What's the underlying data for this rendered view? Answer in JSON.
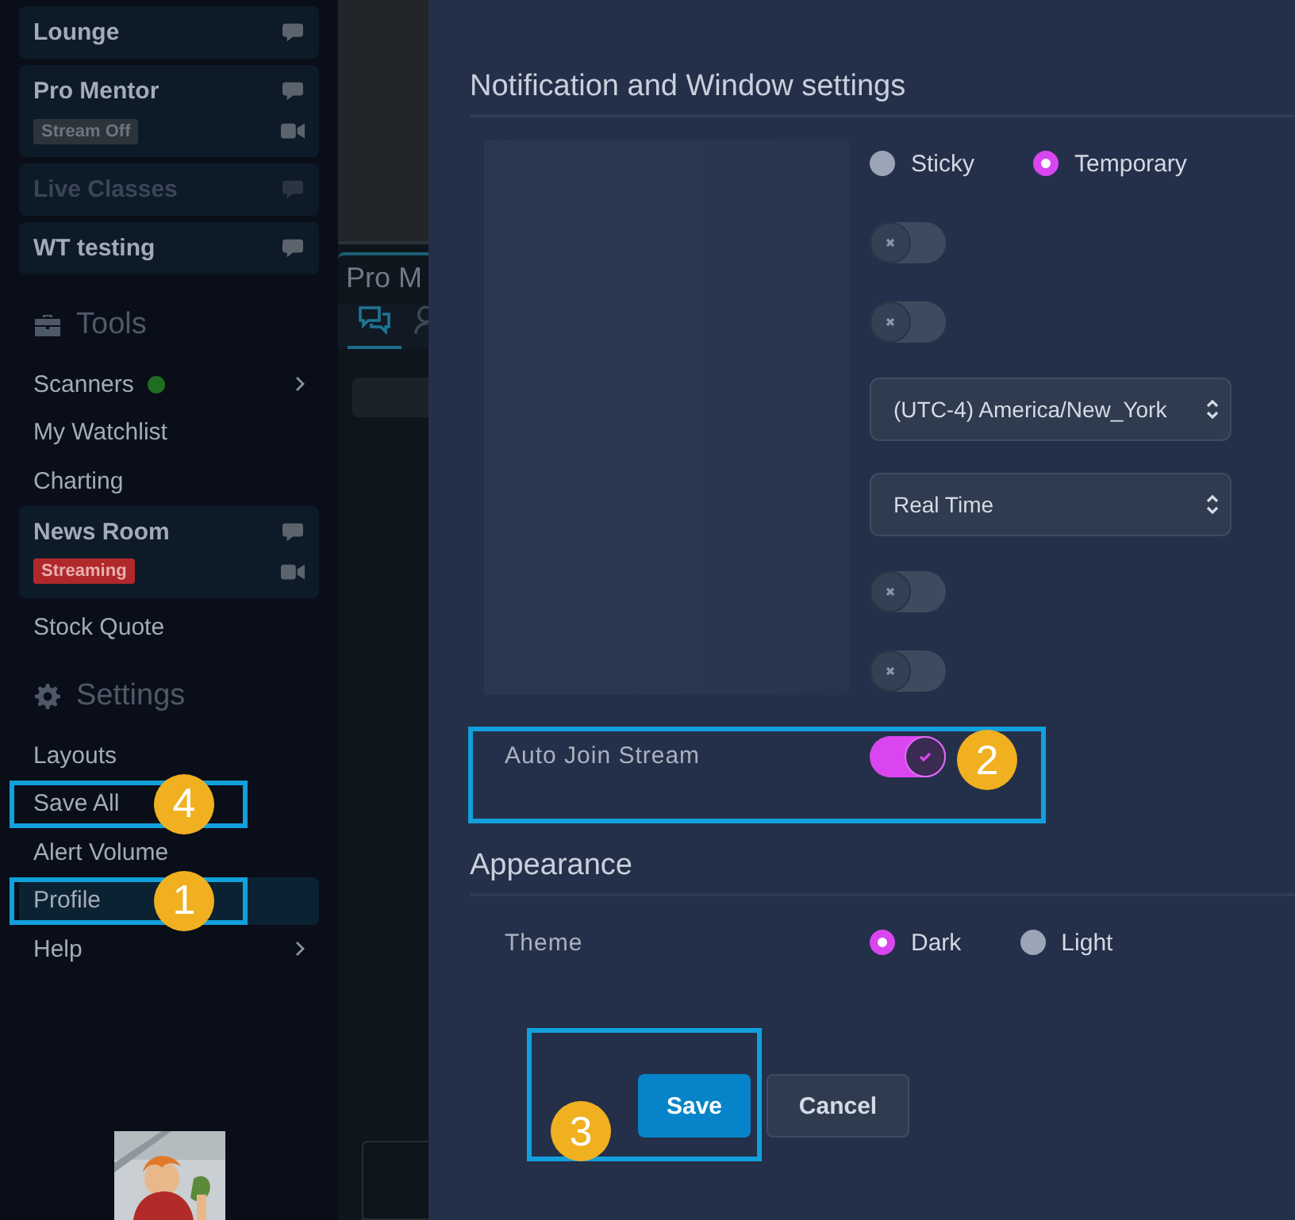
{
  "sidebar": {
    "items": [
      {
        "kind": "room",
        "label": "Lounge",
        "disabled": false
      },
      {
        "kind": "room",
        "label": "Pro Mentor",
        "disabled": false,
        "badge": {
          "text": "Stream Off",
          "live": false
        }
      },
      {
        "kind": "room",
        "label": "Live Classes",
        "disabled": true
      },
      {
        "kind": "room",
        "label": "WT testing",
        "disabled": false
      },
      {
        "kind": "section",
        "label": "Tools"
      },
      {
        "kind": "link",
        "label": "Scanners",
        "online": true,
        "submenu": true,
        "selected": false
      },
      {
        "kind": "link",
        "label": "My Watchlist",
        "selected": false
      },
      {
        "kind": "link",
        "label": "Charting",
        "selected": false
      },
      {
        "kind": "room",
        "label": "News Room",
        "disabled": false,
        "badge": {
          "text": "Streaming",
          "live": true
        }
      },
      {
        "kind": "link",
        "label": "Stock Quote",
        "selected": false
      },
      {
        "kind": "section",
        "label": "Settings"
      },
      {
        "kind": "link",
        "label": "Layouts",
        "selected": false
      },
      {
        "kind": "link",
        "label": "Save All",
        "selected": false,
        "callout": "4"
      },
      {
        "kind": "link",
        "label": "Alert Volume",
        "selected": false
      },
      {
        "kind": "link",
        "label": "Profile",
        "selected": true,
        "callout": "1"
      },
      {
        "kind": "link",
        "label": "Help",
        "submenu": true,
        "selected": false
      }
    ]
  },
  "background_panel": {
    "title": "Pro M"
  },
  "settings": {
    "sections": [
      {
        "title": "Notification and Window settings",
        "rows": [
          {
            "kind": "radio_group",
            "options": [
              {
                "label": "Sticky",
                "selected": false
              },
              {
                "label": "Temporary",
                "selected": true
              }
            ]
          },
          {
            "kind": "toggle",
            "on": false
          },
          {
            "kind": "toggle",
            "on": false
          },
          {
            "kind": "select",
            "value": "(UTC-4) America/New_York"
          },
          {
            "kind": "select",
            "value": "Real Time"
          },
          {
            "kind": "toggle",
            "on": false
          },
          {
            "kind": "toggle",
            "on": false
          },
          {
            "kind": "toggle",
            "label": "Auto Join Stream",
            "on": true,
            "callout": "2"
          }
        ]
      },
      {
        "title": "Appearance",
        "rows": [
          {
            "kind": "radio_group",
            "label": "Theme",
            "options": [
              {
                "label": "Dark",
                "selected": true
              },
              {
                "label": "Light",
                "selected": false
              }
            ]
          }
        ]
      }
    ],
    "buttons": [
      {
        "label": "Save",
        "kind": "primary",
        "callout": "3"
      },
      {
        "label": "Cancel",
        "kind": "secondary"
      }
    ]
  }
}
